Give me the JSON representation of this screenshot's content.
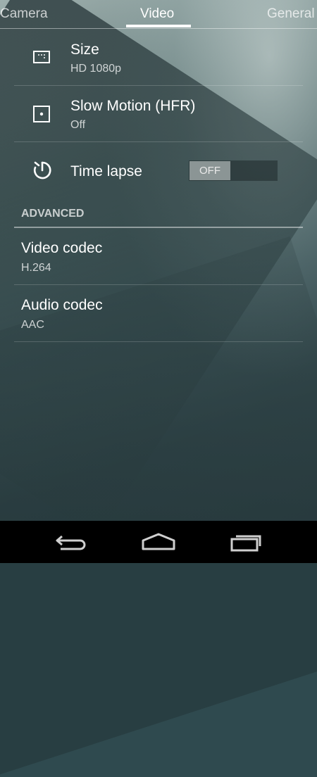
{
  "tabs": [
    {
      "label": "Camera",
      "active": false
    },
    {
      "label": "Video",
      "active": true
    },
    {
      "label": "General",
      "active": false
    }
  ],
  "settings": [
    {
      "title": "Size",
      "summary": "HD 1080p",
      "icon": "aspect-ratio-icon"
    },
    {
      "title": "Slow Motion (HFR)",
      "summary": "Off",
      "icon": "frame-point-icon"
    },
    {
      "title": "Time lapse",
      "icon": "timer-icon",
      "toggle": {
        "state": "OFF"
      }
    }
  ],
  "advanced": {
    "header": "ADVANCED",
    "items": [
      {
        "title": "Video codec",
        "summary": "H.264"
      },
      {
        "title": "Audio codec",
        "summary": "AAC"
      }
    ]
  },
  "navbar": {
    "icons": [
      "back-icon",
      "home-icon",
      "recent-apps-icon"
    ]
  }
}
